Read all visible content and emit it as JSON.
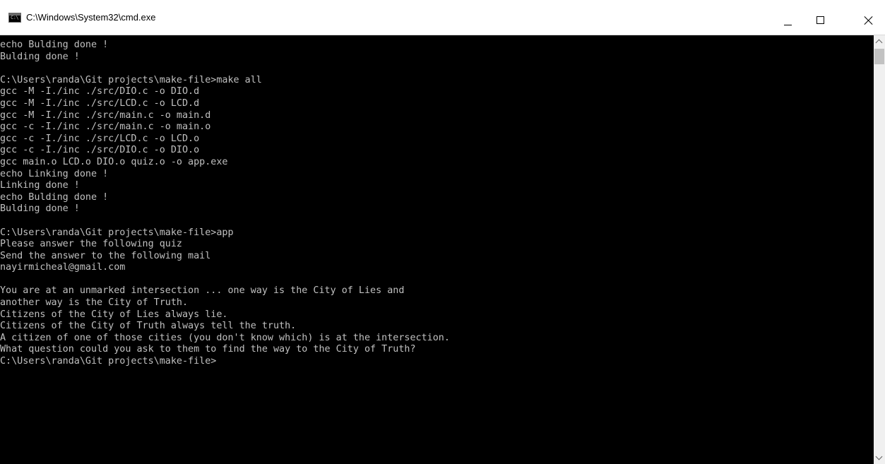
{
  "window": {
    "title": "C:\\Windows\\System32\\cmd.exe",
    "icon": "cmd-icon",
    "controls": {
      "minimize": "minimize-icon",
      "maximize": "maximize-icon",
      "close": "close-icon"
    }
  },
  "console": {
    "colors": {
      "background": "#000000",
      "text": "#c0c0c0"
    },
    "lines": [
      "echo Bulding done !",
      "Bulding done !",
      "",
      "C:\\Users\\randa\\Git projects\\make-file>make all",
      "gcc -M -I./inc ./src/DIO.c -o DIO.d",
      "gcc -M -I./inc ./src/LCD.c -o LCD.d",
      "gcc -M -I./inc ./src/main.c -o main.d",
      "gcc -c -I./inc ./src/main.c -o main.o",
      "gcc -c -I./inc ./src/LCD.c -o LCD.o",
      "gcc -c -I./inc ./src/DIO.c -o DIO.o",
      "gcc main.o LCD.o DIO.o quiz.o -o app.exe",
      "echo Linking done !",
      "Linking done !",
      "echo Bulding done !",
      "Bulding done !",
      "",
      "C:\\Users\\randa\\Git projects\\make-file>app",
      "Please answer the following quiz",
      "Send the answer to the following mail",
      "nayirmicheal@gmail.com",
      "",
      "You are at an unmarked intersection ... one way is the City of Lies and",
      "another way is the City of Truth.",
      "Citizens of the City of Lies always lie.",
      "Citizens of the City of Truth always tell the truth.",
      "A citizen of one of those cities (you don't know which) is at the intersection.",
      "What question could you ask to them to find the way to the City of Truth?",
      "C:\\Users\\randa\\Git projects\\make-file>"
    ]
  },
  "scrollbar": {
    "up": "chevron-up-icon",
    "down": "chevron-down-icon"
  }
}
